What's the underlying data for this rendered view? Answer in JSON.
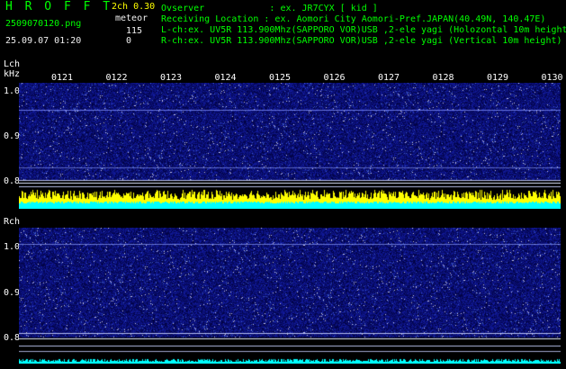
{
  "header": {
    "app_name": "H R O F F T",
    "version": "2ch 0.30",
    "filename": "2509070120.png",
    "timestamp": "25.09.07 01:20",
    "meteor_label": "meteor",
    "meteor_count_1": "115",
    "meteor_count_2": "0",
    "observer_line": "Ovserver            : ex. JR7CYX [ kid ]",
    "location_line": "Receiving Location : ex. Aomori City Aomori-Pref.JAPAN(40.49N, 140.47E)",
    "lch_line": "L-ch:ex. UV5R 113.900Mhz(SAPPORO VOR)USB ,2-ele yagi (Holozontal 10m height)",
    "rch_line": "R-ch:ex. UV5R 113.900Mhz(SAPPORO VOR)USB ,2-ele yagi (Vertical 10m height)"
  },
  "lch": {
    "label": "Lch",
    "unit": "kHz",
    "ticks": [
      "1.0",
      "0.9",
      "0.8"
    ]
  },
  "rch": {
    "label": "Rch",
    "ticks": [
      "1.0",
      "0.9",
      "0.8"
    ]
  },
  "time_ticks": [
    "0121",
    "0122",
    "0123",
    "0124",
    "0125",
    "0126",
    "0127",
    "0128",
    "0129",
    "0130"
  ],
  "colors": {
    "label_green": "#00ff00",
    "text_white": "#f0f0f0",
    "spectrum_blue": "#1a1a9a",
    "meteor_yellow": "#ffff00",
    "level_cyan": "#00ffff"
  }
}
